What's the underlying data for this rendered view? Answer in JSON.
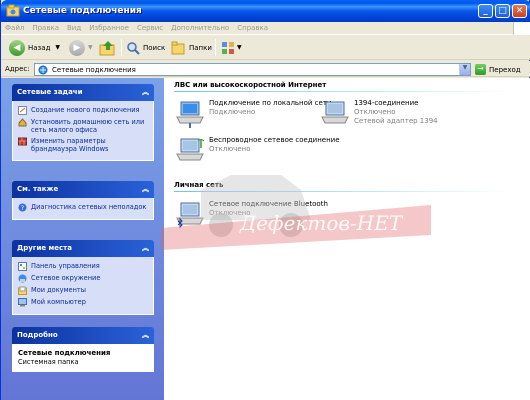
{
  "window": {
    "title": "Сетевые подключения"
  },
  "menubar": {
    "items": [
      "Файл",
      "Правка",
      "Вид",
      "Избранное",
      "Сервис",
      "Дополнительно",
      "Справка"
    ]
  },
  "toolbar": {
    "back": "Назад",
    "search": "Поиск",
    "folders": "Папки"
  },
  "address": {
    "label": "Адрес:",
    "value": "Сетевые подключения",
    "go": "Переход"
  },
  "sidebar": {
    "tasks": {
      "title": "Сетевые задачи",
      "items": [
        "Создание нового подключения",
        "Установить домашнюю сеть или сеть малого офиса",
        "Изменить параметры брандмауэра Windows"
      ]
    },
    "see_also": {
      "title": "См. также",
      "items": [
        "Диагностика сетевых неполадок"
      ]
    },
    "places": {
      "title": "Другие места",
      "items": [
        "Панель управления",
        "Сетевое окружение",
        "Мои документы",
        "Мой компьютер"
      ]
    },
    "details": {
      "title": "Подробно",
      "name": "Сетевые подключения",
      "type": "Системная папка"
    }
  },
  "groups": [
    {
      "title": "ЛВС или высокоскоростной Интернет",
      "items": [
        {
          "name": "Подключение по локальной сети",
          "status": "Подключено",
          "device": ""
        },
        {
          "name": "1394-соединение",
          "status": "Отключено",
          "device": "Сетевой адаптер 1394"
        },
        {
          "name": "Беспроводное сетевое соединение",
          "status": "Отключено",
          "device": ""
        }
      ]
    },
    {
      "title": "Личная сеть",
      "items": [
        {
          "name": "Сетевое подключение Bluetooth",
          "status": "Отключено",
          "device": ""
        }
      ]
    }
  ],
  "watermark": {
    "text": "Дефектов-НЕТ"
  },
  "colors": {
    "title_blue": "#0058ee",
    "sidebar_blue": "#6f8fe0",
    "link_blue": "#0b2b9b"
  }
}
